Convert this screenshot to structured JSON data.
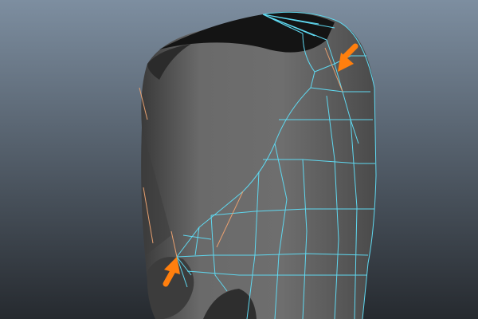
{
  "viewport": {
    "background_top": "#7d8ea0",
    "background_bottom": "#262a2f",
    "mesh_color": "#5e5e5e",
    "wireframe_color": "#5fd8f0",
    "edge_highlight_color": "#e8a070",
    "arrow_color": "#ff7f0e"
  },
  "annotations": [
    {
      "icon": "arrow-down-left-icon"
    },
    {
      "icon": "arrow-up-left-icon"
    }
  ]
}
